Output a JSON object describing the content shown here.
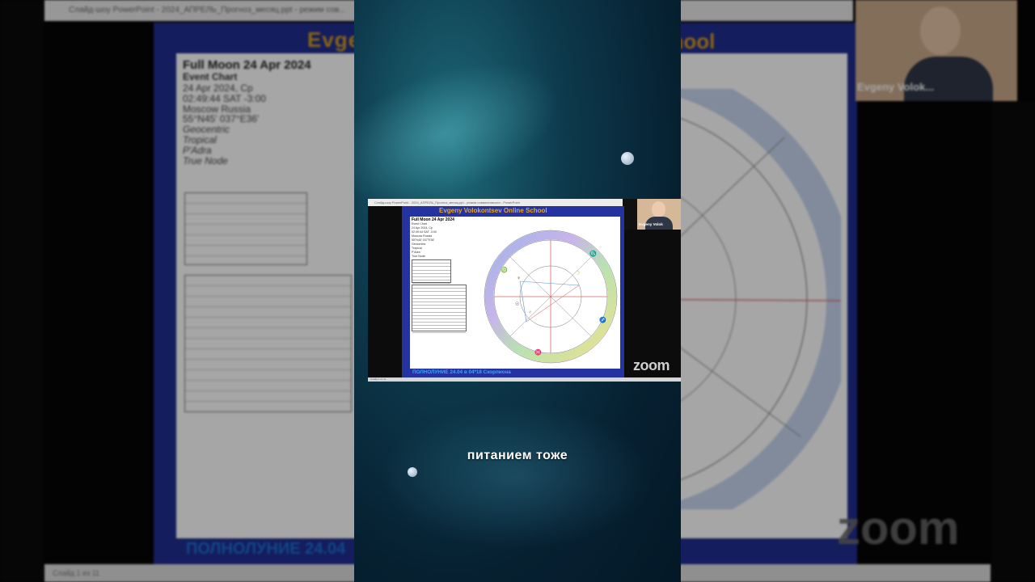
{
  "background": {
    "window_title": "Слайд-шоу PowerPoint  -  2024_АПРЕЛЬ_Прогноз_месяц.ppt  -  режим сов...",
    "school_fragment_left": "Evgeny",
    "school_fragment_right": "chool",
    "event": {
      "title": "Full Moon 24 Apr 2024",
      "subtitle": "Event Chart",
      "lines": [
        "24 Apr 2024, Ср",
        "02:49:44 SAT -3:00",
        "Moscow Russia",
        "55°N45' 037°E36'",
        "Geocentric",
        "Tropical",
        "P'Adra",
        "True Node"
      ]
    },
    "bottom_text": "ПОЛНОЛУНИЕ 24.04",
    "status_left": "Слайд 1 из 11",
    "camera_name": "Evgeny Volok...",
    "zoom_logo": "zoom"
  },
  "video": {
    "titlebar": "Слайд-шоу PowerPoint  -  2024_АПРЕЛЬ_Прогноз_месяц.ppt  -  режим совместимости  -  PowerPoint",
    "school_title": "Evgeny Volokontsev Online School",
    "event": {
      "title": "Full Moon 24 Apr 2024",
      "subtitle": "Event Chart",
      "lines": [
        "24 Apr 2024, Ср",
        "02:49:44 SAT -3:00",
        "Moscow Russia",
        "55°N45' 037°E36'",
        "Geocentric",
        "Tropical",
        "P'Adra",
        "True Node"
      ]
    },
    "bottom_text": "ПОЛНОЛУНИЕ 24.04 в 04*18 Скорпиона",
    "status": "Слайд 1 из 11",
    "camera_name": "Evgeny Volok",
    "zoom_logo": "zoom"
  },
  "caption": "питанием тоже",
  "colors": {
    "slide_blue": "#2433a0",
    "school_gold": "#e8a823",
    "bottom_text_blue": "#3ba4ff",
    "caption": "#ffffff"
  }
}
